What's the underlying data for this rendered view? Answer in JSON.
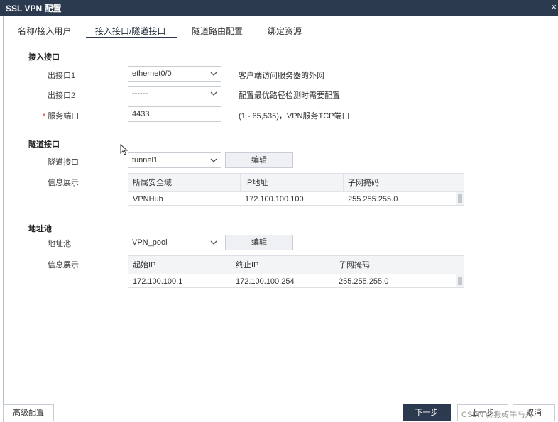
{
  "window": {
    "title": "SSL VPN 配置",
    "close_glyph": "×"
  },
  "tabs": [
    {
      "label": "名称/接入用户"
    },
    {
      "label": "接入接口/隧道接口"
    },
    {
      "label": "隧道路由配置"
    },
    {
      "label": "绑定资源"
    }
  ],
  "access": {
    "section": "接入接口",
    "out1": {
      "label": "出接口1",
      "value": "ethernet0/0",
      "hint": "客户端访问服务器的外网"
    },
    "out2": {
      "label": "出接口2",
      "value": "------",
      "hint": "配置最优路径检测时需要配置"
    },
    "port": {
      "required_mark": "*",
      "label": "服务端口",
      "value": "4433",
      "hint": "(1 - 65,535)，VPN服务TCP端口"
    }
  },
  "tunnel": {
    "section": "隧道接口",
    "iface_label": "隧道接口",
    "iface_value": "tunnel1",
    "edit_label": "编辑",
    "info_label": "信息展示",
    "columns": [
      "所属安全域",
      "IP地址",
      "子网掩码"
    ],
    "rows": [
      [
        "VPNHub",
        "172.100.100.100",
        "255.255.255.0"
      ]
    ]
  },
  "pool": {
    "section": "地址池",
    "pool_label": "地址池",
    "pool_value": "VPN_pool",
    "edit_label": "编辑",
    "info_label": "信息展示",
    "columns": [
      "起始IP",
      "终止IP",
      "子网掩码"
    ],
    "rows": [
      [
        "172.100.100.1",
        "172.100.100.254",
        "255.255.255.0"
      ]
    ]
  },
  "footer": {
    "advanced": "高级配置",
    "next": "下一步",
    "prev": "上一步",
    "cancel": "取消",
    "watermark": "CSDN @搬砖牛马人"
  },
  "colors": {
    "titlebar": "#2c3a4f",
    "primary_button": "#2c3a4f",
    "required": "#e23b3b"
  }
}
